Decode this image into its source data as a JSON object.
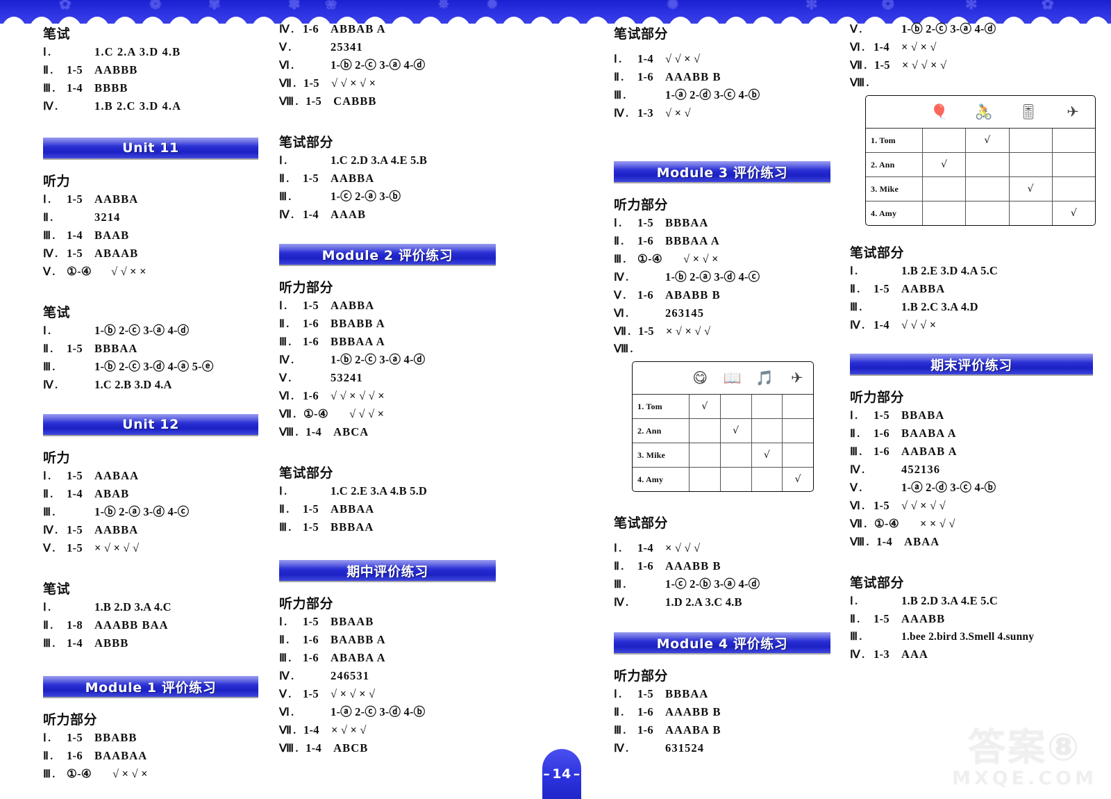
{
  "page": {
    "number": "14",
    "watermark_cn": "答案⑧",
    "watermark_en": "MXQE.COM"
  },
  "headings": {
    "bishi": "笔试",
    "tingli": "听力",
    "tingli_bufen": "听力部分",
    "bishi_bufen": "笔试部分"
  },
  "banners": {
    "unit11": "Unit 11",
    "unit12": "Unit 12",
    "module1": "Module 1 评价练习",
    "module2": "Module 2 评价练习",
    "module3": "Module 3 评价练习",
    "module4": "Module 4 评价练习",
    "midterm": "期中评价练习",
    "final": "期末评价练习"
  },
  "col1": {
    "top_bishi": {
      "title": "笔试",
      "items": [
        {
          "rn": "Ⅰ",
          "range": "",
          "vals": "1.C    2.A    3.D    4.B"
        },
        {
          "rn": "Ⅱ",
          "range": "1-5",
          "vals": "AABBB"
        },
        {
          "rn": "Ⅲ",
          "range": "1-4",
          "vals": "BBBB"
        },
        {
          "rn": "Ⅳ",
          "range": "",
          "vals": "1.B    2.C    3.D     4.A"
        }
      ]
    },
    "unit11_tingli": {
      "title": "听力",
      "items": [
        {
          "rn": "Ⅰ",
          "range": "1-5",
          "vals": "AABBA"
        },
        {
          "rn": "Ⅱ",
          "range": "",
          "vals": "3214"
        },
        {
          "rn": "Ⅲ",
          "range": "1-4",
          "vals": "BAAB"
        },
        {
          "rn": "Ⅳ",
          "range": "1-5",
          "vals": "ABAAB"
        },
        {
          "rn": "Ⅴ",
          "range": "①-④",
          "vals": "√ √ × ×"
        }
      ]
    },
    "unit11_bishi": {
      "title": "笔试",
      "items": [
        {
          "rn": "Ⅰ",
          "range": "",
          "vals": "1-ⓑ  2-ⓒ  3-ⓐ  4-ⓓ"
        },
        {
          "rn": "Ⅱ",
          "range": "1-5",
          "vals": "BBBAA"
        },
        {
          "rn": "Ⅲ",
          "range": "",
          "vals": "1-ⓑ  2-ⓒ  3-ⓓ  4-ⓐ  5-ⓔ"
        },
        {
          "rn": "Ⅳ",
          "range": "",
          "vals": "1.C  2.B  3.D  4.A"
        }
      ]
    },
    "unit12_tingli": {
      "title": "听力",
      "items": [
        {
          "rn": "Ⅰ",
          "range": "1-5",
          "vals": "AABAA"
        },
        {
          "rn": "Ⅱ",
          "range": "1-4",
          "vals": "ABAB"
        },
        {
          "rn": "Ⅲ",
          "range": "",
          "vals": "1-ⓑ  2-ⓐ  3-ⓓ  4-ⓒ"
        },
        {
          "rn": "Ⅳ",
          "range": "1-5",
          "vals": "AABBA"
        },
        {
          "rn": "Ⅴ",
          "range": "1-5",
          "vals": "× √ × √ √"
        }
      ]
    },
    "unit12_bishi": {
      "title": "笔试",
      "items": [
        {
          "rn": "Ⅰ",
          "range": "",
          "vals": "1.B  2.D  3.A  4.C"
        },
        {
          "rn": "Ⅱ",
          "range": "1-8",
          "vals": "AAABB BAA"
        },
        {
          "rn": "Ⅲ",
          "range": "1-4",
          "vals": "ABBB"
        }
      ]
    },
    "module1_tingli": {
      "title": "听力部分",
      "items": [
        {
          "rn": "Ⅰ",
          "range": "1-5",
          "vals": "BBABB"
        },
        {
          "rn": "Ⅱ",
          "range": "1-6",
          "vals": "BAABAA"
        },
        {
          "rn": "Ⅲ",
          "range": "①-④",
          "vals": "√ × √ ×"
        }
      ]
    }
  },
  "col2": {
    "module1_tingli_cont": {
      "items": [
        {
          "rn": "Ⅳ",
          "range": "1-6",
          "vals": "ABBAB A"
        },
        {
          "rn": "Ⅴ",
          "range": "",
          "vals": "25341"
        },
        {
          "rn": "Ⅵ",
          "range": "",
          "vals": "1-ⓑ  2-ⓒ  3-ⓐ  4-ⓓ"
        },
        {
          "rn": "Ⅶ",
          "range": "1-5",
          "vals": "√ √ × √ ×"
        },
        {
          "rn": "Ⅷ",
          "range": "1-5",
          "vals": "CABBB"
        }
      ]
    },
    "module1_bishi": {
      "title": "笔试部分",
      "items": [
        {
          "rn": "Ⅰ",
          "range": "",
          "vals": "1.C  2.D  3.A  4.E  5.B"
        },
        {
          "rn": "Ⅱ",
          "range": "1-5",
          "vals": "AABBA"
        },
        {
          "rn": "Ⅲ",
          "range": "",
          "vals": "1-ⓒ  2-ⓐ  3-ⓑ"
        },
        {
          "rn": "Ⅳ",
          "range": "1-4",
          "vals": "AAAB"
        }
      ]
    },
    "module2_tingli": {
      "title": "听力部分",
      "items": [
        {
          "rn": "Ⅰ",
          "range": "1-5",
          "vals": "AABBA"
        },
        {
          "rn": "Ⅱ",
          "range": "1-6",
          "vals": "BBABB A"
        },
        {
          "rn": "Ⅲ",
          "range": "1-6",
          "vals": "BBBAA A"
        },
        {
          "rn": "Ⅳ",
          "range": "",
          "vals": "1-ⓑ  2-ⓒ  3-ⓐ  4-ⓓ"
        },
        {
          "rn": "Ⅴ",
          "range": "",
          "vals": "53241"
        },
        {
          "rn": "Ⅵ",
          "range": "1-6",
          "vals": "√ √ × √ √ ×"
        },
        {
          "rn": "Ⅶ",
          "range": "①-④",
          "vals": "√ √ √ ×"
        },
        {
          "rn": "Ⅷ",
          "range": "1-4",
          "vals": "ABCA"
        }
      ]
    },
    "module2_bishi": {
      "title": "笔试部分",
      "items": [
        {
          "rn": "Ⅰ",
          "range": "",
          "vals": "1.C  2.E  3.A  4.B  5.D"
        },
        {
          "rn": "Ⅱ",
          "range": "1-5",
          "vals": "ABBAA"
        },
        {
          "rn": "Ⅲ",
          "range": "1-5",
          "vals": "BBBAA"
        }
      ]
    },
    "midterm_tingli": {
      "title": "听力部分",
      "items": [
        {
          "rn": "Ⅰ",
          "range": "1-5",
          "vals": "BBAAB"
        },
        {
          "rn": "Ⅱ",
          "range": "1-6",
          "vals": "BAABB A"
        },
        {
          "rn": "Ⅲ",
          "range": "1-6",
          "vals": "ABABA A"
        },
        {
          "rn": "Ⅳ",
          "range": "",
          "vals": "246531"
        },
        {
          "rn": "Ⅴ",
          "range": "1-5",
          "vals": "√ × √ × √"
        },
        {
          "rn": "Ⅵ",
          "range": "",
          "vals": "1-ⓐ  2-ⓒ  3-ⓓ  4-ⓑ"
        },
        {
          "rn": "Ⅶ",
          "range": "1-4",
          "vals": "× √ × √"
        },
        {
          "rn": "Ⅷ",
          "range": "1-4",
          "vals": "ABCB"
        }
      ]
    }
  },
  "col3": {
    "midterm_bishi": {
      "title": "笔试部分",
      "items": [
        {
          "rn": "Ⅰ",
          "range": "1-4",
          "vals": "√ √ × √"
        },
        {
          "rn": "Ⅱ",
          "range": "1-6",
          "vals": "AAABB B"
        },
        {
          "rn": "Ⅲ",
          "range": "",
          "vals": "1-ⓐ  2-ⓓ  3-ⓒ  4-ⓑ"
        },
        {
          "rn": "Ⅳ",
          "range": "1-3",
          "vals": "√ × √"
        }
      ]
    },
    "module3_tingli": {
      "title": "听力部分",
      "items": [
        {
          "rn": "Ⅰ",
          "range": "1-5",
          "vals": "BBBAA"
        },
        {
          "rn": "Ⅱ",
          "range": "1-6",
          "vals": "BBBAA A"
        },
        {
          "rn": "Ⅲ",
          "range": "①-④",
          "vals": "√ × √ ×"
        },
        {
          "rn": "Ⅳ",
          "range": "",
          "vals": "1-ⓑ  2-ⓐ  3-ⓓ  4-ⓒ"
        },
        {
          "rn": "Ⅴ",
          "range": "1-6",
          "vals": "ABABB B"
        },
        {
          "rn": "Ⅵ",
          "range": "",
          "vals": "263145"
        },
        {
          "rn": "Ⅶ",
          "range": "1-5",
          "vals": "× √ × √ √"
        },
        {
          "rn": "Ⅷ",
          "range": "",
          "vals": ""
        }
      ]
    },
    "module3_table": {
      "col_icons": [
        "icon-eat",
        "icon-read-book",
        "icon-listen",
        "icon-play"
      ],
      "rows": [
        {
          "label": "1. Tom",
          "marks": [
            "√",
            "",
            "",
            ""
          ]
        },
        {
          "label": "2. Ann",
          "marks": [
            "",
            "√",
            "",
            ""
          ]
        },
        {
          "label": "3. Mike",
          "marks": [
            "",
            "",
            "√",
            ""
          ]
        },
        {
          "label": "4. Amy",
          "marks": [
            "",
            "",
            "",
            "√"
          ]
        }
      ]
    },
    "module3_bishi": {
      "title": "笔试部分",
      "items": [
        {
          "rn": "Ⅰ",
          "range": "1-4",
          "vals": "× √ √ √"
        },
        {
          "rn": "Ⅱ",
          "range": "1-6",
          "vals": "AAABB B"
        },
        {
          "rn": "Ⅲ",
          "range": "",
          "vals": "1-ⓒ  2-ⓑ  3-ⓐ  4-ⓓ"
        },
        {
          "rn": "Ⅳ",
          "range": "",
          "vals": "1.D  2.A  3.C  4.B"
        }
      ]
    },
    "module4_tingli": {
      "title": "听力部分",
      "items": [
        {
          "rn": "Ⅰ",
          "range": "1-5",
          "vals": "BBBAA"
        },
        {
          "rn": "Ⅱ",
          "range": "1-6",
          "vals": "AAABB B"
        },
        {
          "rn": "Ⅲ",
          "range": "1-6",
          "vals": "AAABA B"
        },
        {
          "rn": "Ⅳ",
          "range": "",
          "vals": "631524"
        }
      ]
    }
  },
  "col4": {
    "module4_tingli_cont": {
      "items": [
        {
          "rn": "Ⅴ",
          "range": "",
          "vals": "1-ⓑ  2-ⓒ  3-ⓐ  4-ⓓ"
        },
        {
          "rn": "Ⅵ",
          "range": "1-4",
          "vals": "× √ × √"
        },
        {
          "rn": "Ⅶ",
          "range": "1-5",
          "vals": "× √ √ × √"
        },
        {
          "rn": "Ⅷ",
          "range": "",
          "vals": ""
        }
      ]
    },
    "module4_table": {
      "col_icons": [
        "icon-sweep",
        "icon-cook",
        "icon-wash",
        "icon-clean"
      ],
      "rows": [
        {
          "label": "1. Tom",
          "marks": [
            "",
            "√",
            "",
            ""
          ]
        },
        {
          "label": "2. Ann",
          "marks": [
            "√",
            "",
            "",
            ""
          ]
        },
        {
          "label": "3. Mike",
          "marks": [
            "",
            "",
            "√",
            ""
          ]
        },
        {
          "label": "4. Amy",
          "marks": [
            "",
            "",
            "",
            "√"
          ]
        }
      ]
    },
    "module4_bishi": {
      "title": "笔试部分",
      "items": [
        {
          "rn": "Ⅰ",
          "range": "",
          "vals": "1.B  2.E  3.D   4.A   5.C"
        },
        {
          "rn": "Ⅱ",
          "range": "1-5",
          "vals": "AABBA"
        },
        {
          "rn": "Ⅲ",
          "range": "",
          "vals": "1.B   2.C   3.A   4.D"
        },
        {
          "rn": "Ⅳ",
          "range": "1-4",
          "vals": "√ √ √ ×"
        }
      ]
    },
    "final_tingli": {
      "title": "听力部分",
      "items": [
        {
          "rn": "Ⅰ",
          "range": "1-5",
          "vals": "BBABA"
        },
        {
          "rn": "Ⅱ",
          "range": "1-6",
          "vals": "BAABA A"
        },
        {
          "rn": "Ⅲ",
          "range": "1-6",
          "vals": "AABAB A"
        },
        {
          "rn": "Ⅳ",
          "range": "",
          "vals": "452136"
        },
        {
          "rn": "Ⅴ",
          "range": "",
          "vals": "1-ⓐ  2-ⓓ  3-ⓒ  4-ⓑ"
        },
        {
          "rn": "Ⅵ",
          "range": "1-5",
          "vals": "√ √ × √ √"
        },
        {
          "rn": "Ⅶ",
          "range": "①-④",
          "vals": "× × √ √"
        },
        {
          "rn": "Ⅷ",
          "range": "1-4",
          "vals": "ABAA"
        }
      ]
    },
    "final_bishi": {
      "title": "笔试部分",
      "items": [
        {
          "rn": "Ⅰ",
          "range": "",
          "vals": "1.B  2.D  3.A   4.E   5.C"
        },
        {
          "rn": "Ⅱ",
          "range": "1-5",
          "vals": "AAABB"
        },
        {
          "rn": "Ⅲ",
          "range": "",
          "vals": "1.bee   2.bird   3.Smell   4.sunny"
        },
        {
          "rn": "Ⅳ",
          "range": "1-3",
          "vals": "AAA"
        }
      ]
    }
  },
  "decor": {
    "top_glyphs": [
      "✿",
      "✾",
      "❁",
      "✽",
      "❀",
      "✵",
      "✹",
      "✺",
      "✼",
      "❂",
      "✻",
      "✿",
      "❁",
      "✾"
    ]
  }
}
